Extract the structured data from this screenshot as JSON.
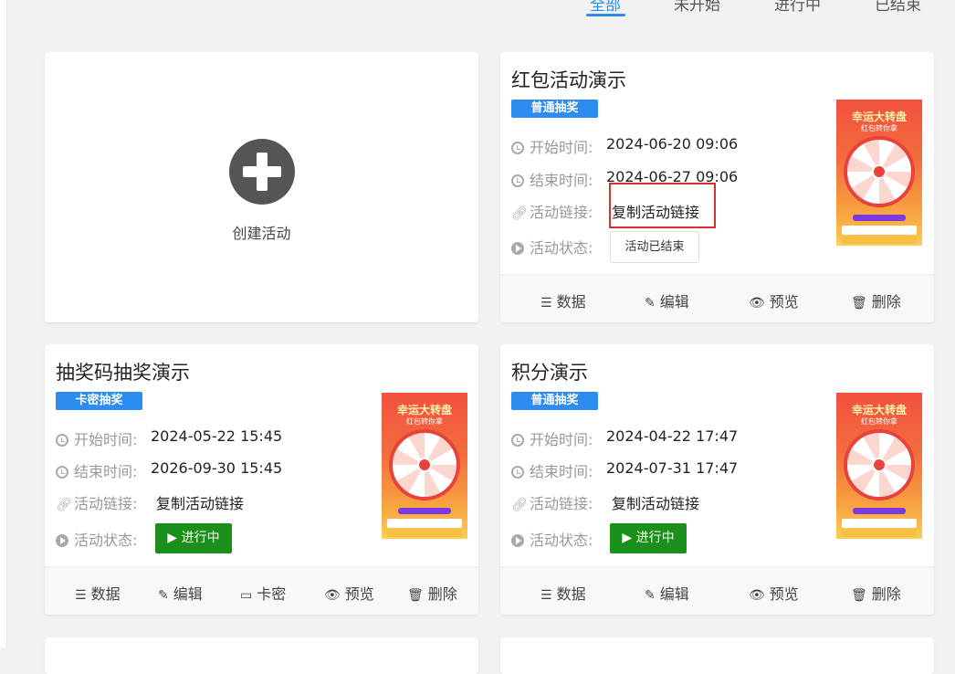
{
  "tabs": [
    "全部",
    "未开始",
    "进行中",
    "已结束"
  ],
  "create": {
    "label": "创建活动"
  },
  "field_labels": {
    "start": "开始时间:",
    "end": "结束时间:",
    "link": "活动链接:",
    "status": "活动状态:"
  },
  "actions": {
    "data": "数据",
    "edit": "编辑",
    "card": "卡密",
    "preview": "预览",
    "delete": "删除"
  },
  "thumb": {
    "title": "幸运大转盘",
    "subtitle": "红包转你拿"
  },
  "cards": [
    {
      "title": "红包活动演示",
      "badge": "普通抽奖",
      "start": "2024-06-20 09:06",
      "end": "2024-06-27 09:06",
      "link": "复制活动链接",
      "status": "活动已结束"
    },
    {
      "title": "抽奖码抽奖演示",
      "badge": "卡密抽奖",
      "start": "2024-05-22 15:45",
      "end": "2026-09-30 15:45",
      "link": "复制活动链接",
      "status": "进行中"
    },
    {
      "title": "积分演示",
      "badge": "普通抽奖",
      "start": "2024-04-22 17:47",
      "end": "2024-07-31 17:47",
      "link": "复制活动链接",
      "status": "进行中"
    }
  ],
  "colors": {
    "accent": "#2d8cf0",
    "active": "#1a8f1a",
    "highlight": "#d9322c"
  }
}
